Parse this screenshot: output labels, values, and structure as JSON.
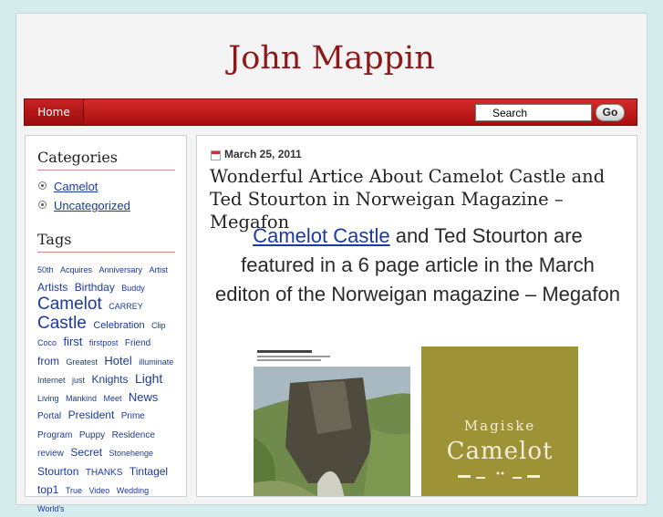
{
  "site": {
    "title": "John Mappin"
  },
  "nav": {
    "home_label": "Home"
  },
  "search": {
    "placeholder": "Search",
    "value": "Search",
    "go_label": "Go"
  },
  "sidebar": {
    "categories_title": "Categories",
    "categories": [
      {
        "label": "Camelot"
      },
      {
        "label": "Uncategorized"
      }
    ],
    "tags_title": "Tags",
    "tags": [
      {
        "label": "50th",
        "size": 9
      },
      {
        "label": "Acquires",
        "size": 9
      },
      {
        "label": "Anniversary",
        "size": 9
      },
      {
        "label": "Artist",
        "size": 9
      },
      {
        "label": "Artists",
        "size": 12
      },
      {
        "label": "Birthday",
        "size": 12
      },
      {
        "label": "Buddy",
        "size": 9
      },
      {
        "label": "Camelot",
        "size": 19
      },
      {
        "label": "CARREY",
        "size": 9
      },
      {
        "label": "Castle",
        "size": 19
      },
      {
        "label": "Celebration",
        "size": 11
      },
      {
        "label": "Clip",
        "size": 9
      },
      {
        "label": "Coco",
        "size": 9
      },
      {
        "label": "first",
        "size": 13
      },
      {
        "label": "firstpost",
        "size": 9
      },
      {
        "label": "Friend",
        "size": 10
      },
      {
        "label": "from",
        "size": 12
      },
      {
        "label": "Greatest",
        "size": 9
      },
      {
        "label": "Hotel",
        "size": 13
      },
      {
        "label": "illuminate",
        "size": 9
      },
      {
        "label": "Internet",
        "size": 9
      },
      {
        "label": "just",
        "size": 9
      },
      {
        "label": "Knights",
        "size": 12
      },
      {
        "label": "Light",
        "size": 14
      },
      {
        "label": "Living",
        "size": 9
      },
      {
        "label": "Mankind",
        "size": 9
      },
      {
        "label": "Meet",
        "size": 9
      },
      {
        "label": "News",
        "size": 13
      },
      {
        "label": "Portal",
        "size": 10
      },
      {
        "label": "President",
        "size": 12
      },
      {
        "label": "Prime",
        "size": 10
      },
      {
        "label": "Program",
        "size": 10
      },
      {
        "label": "Puppy",
        "size": 10
      },
      {
        "label": "Residence",
        "size": 10
      },
      {
        "label": "review",
        "size": 10
      },
      {
        "label": "Secret",
        "size": 12
      },
      {
        "label": "Stonehenge",
        "size": 9
      },
      {
        "label": "Stourton",
        "size": 12
      },
      {
        "label": "THANKS",
        "size": 10
      },
      {
        "label": "Tintagel",
        "size": 12
      },
      {
        "label": "top1",
        "size": 12
      },
      {
        "label": "True",
        "size": 9
      },
      {
        "label": "Video",
        "size": 9
      },
      {
        "label": "Wedding",
        "size": 9
      },
      {
        "label": "World's",
        "size": 9
      }
    ]
  },
  "post": {
    "date": "March 25, 2011",
    "title": "Wonderful Artice About Camelot Castle and Ted Stourton in Norweigan Magazine – Megafon",
    "lead_link": "Camelot Castle",
    "lead_text": " and Ted Stourton are featured in a 6 page article in the March editon of the Norweigan magazine – Megafon",
    "magazine_line1": "Magiske",
    "magazine_line2": "Camelot"
  },
  "colors": {
    "accent": "#8e1818",
    "nav_red": "#c21c1c",
    "link": "#1a3aa0",
    "background": "#d4ecec"
  },
  "icons": {
    "calendar": "calendar-icon",
    "bullet": "bullet-icon"
  }
}
